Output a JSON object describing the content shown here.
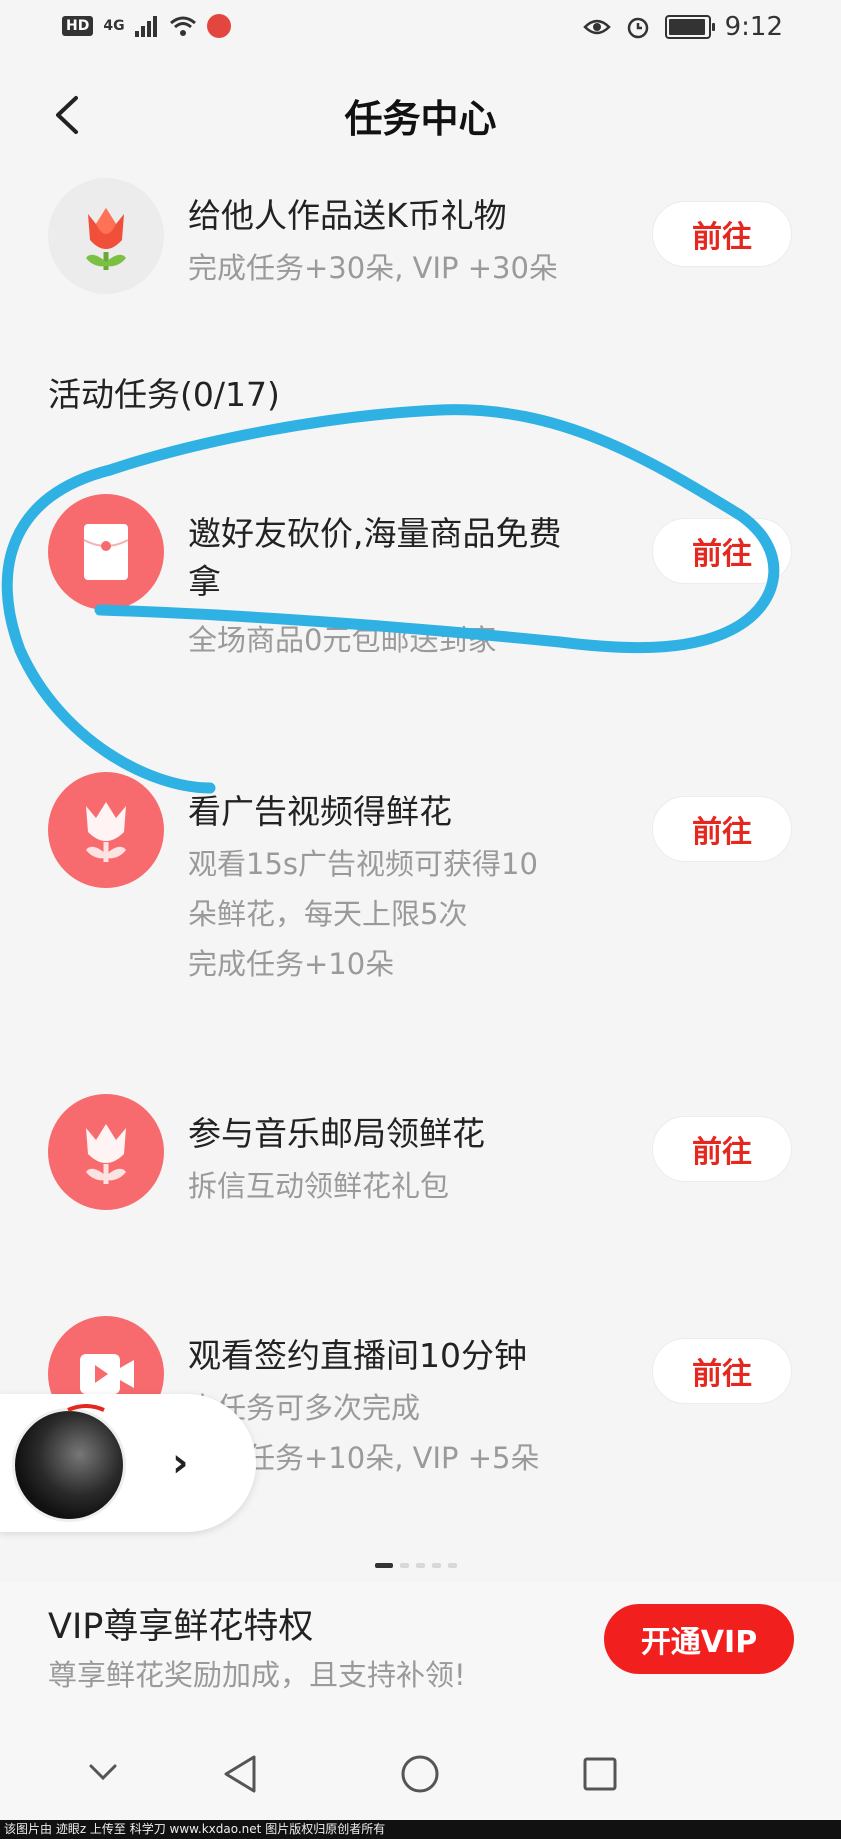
{
  "status_bar": {
    "hd": "HD",
    "network": "4G",
    "time": "9:12",
    "icons": [
      "signal-icon",
      "wifi-icon",
      "app-notification-icon",
      "eye-icon",
      "alarm-icon",
      "battery-icon"
    ]
  },
  "header": {
    "title": "任务中心",
    "back_icon": "chevron-left-icon"
  },
  "tasks_top": [
    {
      "name": "给他人作品送K币礼物",
      "sub1": "完成任务+30朵, VIP +30朵",
      "button": "前往",
      "icon": "tulip-icon"
    }
  ],
  "section": {
    "title": "活动任务(0/17)"
  },
  "tasks": [
    {
      "name1": "邀好友砍价,海量商品免费",
      "name2": "拿",
      "sub1": "全场商品0元包邮送到家",
      "button": "前往",
      "icon": "red-envelope-icon"
    },
    {
      "name1": "看广告视频得鲜花",
      "sub1": "观看15s广告视频可获得10",
      "sub2": "朵鲜花，每天上限5次",
      "sub3": "完成任务+10朵",
      "button": "前往",
      "icon": "flower-icon"
    },
    {
      "name1": "参与音乐邮局领鲜花",
      "sub1": "拆信互动领鲜花礼包",
      "button": "前往",
      "icon": "flower-icon"
    },
    {
      "name1": "观看签约直播间10分钟",
      "sub1": "本任务可多次完成",
      "sub2": "完成任务+10朵, VIP +5朵",
      "button": "前往",
      "icon": "video-camera-icon"
    }
  ],
  "carousel": {
    "pages": 5,
    "active": 1
  },
  "vip": {
    "title": "VIP尊享鲜花特权",
    "subtitle": "尊享鲜花奖励加成，且支持补领!",
    "button": "开通VIP"
  },
  "mini_player": {
    "arrow": "›",
    "icon": "chevron-right-icon"
  },
  "navbar": {
    "icons": [
      "chevron-down-icon",
      "back-triangle-icon",
      "home-circle-icon",
      "recents-square-icon"
    ]
  },
  "footer": {
    "text": "该图片由 迹眼z 上传至 科学刀 www.kxdao.net 图片版权归原创者所有"
  },
  "colors": {
    "accent": "#e5281f",
    "vip_button": "#f21f1f",
    "icon_bg": "#f76b6e",
    "annotation": "#2fb1e4"
  }
}
